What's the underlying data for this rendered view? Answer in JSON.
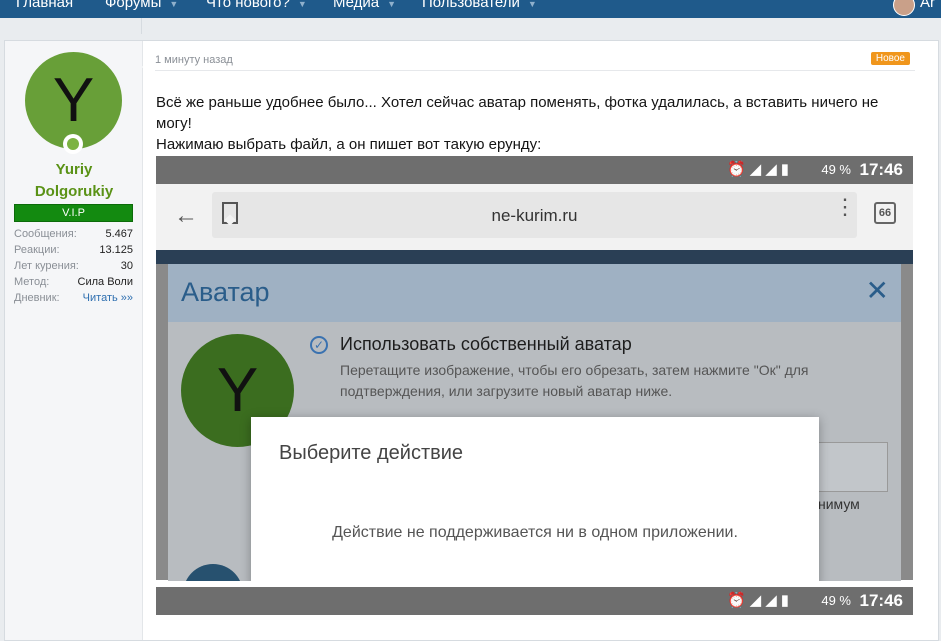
{
  "nav": {
    "items": [
      "Главная",
      "Форумы",
      "Что нового?",
      "Медиа",
      "Пользователи"
    ],
    "user_partial": "Ar"
  },
  "post": {
    "author": {
      "avatar_letter": "Y",
      "name_line1": "Yuriy",
      "name_line2": "Dolgorukiy",
      "badge": "V.I.P",
      "stats": [
        {
          "label": "Сообщения:",
          "value": "5.467"
        },
        {
          "label": "Реакции:",
          "value": "13.125"
        },
        {
          "label": "Лет курения:",
          "value": "30"
        },
        {
          "label": "Метод:",
          "value": "Сила Воли"
        },
        {
          "label": "Дневник:",
          "value": "Читать »»"
        }
      ]
    },
    "time": "1 минуту назад",
    "new_badge": "Новое",
    "text_line1": "Всё же раньше удобнее было... Хотел сейчас аватар поменять, фотка удалилась, а вставить ничего не могу!",
    "text_line2": "Нажимаю выбрать файл, а он пишет вот такую ерунду:",
    "screenshot": {
      "battery": "49 %",
      "time": "17:46",
      "url": "ne-kurim.ru",
      "tab_count": "66",
      "dialog_title": "Аватар",
      "avatar_letter": "Y",
      "option_title": "Использовать собственный аватар",
      "option_desc": "Перетащите изображение, чтобы его обрезать, затем нажмите \"Ок\" для подтверждения, или загрузите новый аватар ниже.",
      "min_text": "нимум",
      "modal_title": "Выберите действие",
      "modal_body": "Действие не поддерживается ни в одном приложении."
    }
  },
  "colors": {
    "nav_bg": "#1f5a8b",
    "username": "#5a9216",
    "vip_bg": "#138a10",
    "new_badge": "#f0961c",
    "avatar_bg": "#689f38"
  }
}
